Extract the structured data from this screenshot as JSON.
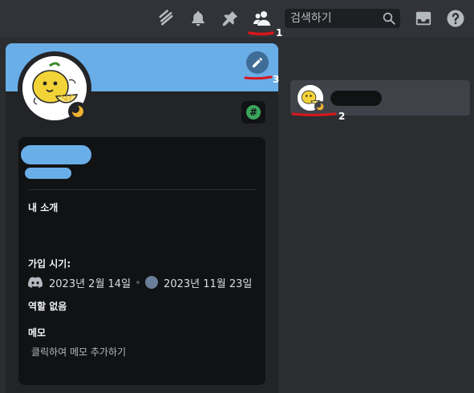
{
  "toolbar": {
    "icons": [
      "threads-icon",
      "bell-icon",
      "pin-icon",
      "members-icon",
      "inbox-icon",
      "help-icon"
    ],
    "search_placeholder": "검색하기"
  },
  "annotations": [
    "1",
    "2",
    "3"
  ],
  "profile": {
    "banner_color": "#6aaee8",
    "about_title": "내 소개",
    "member_since_title": "가입 시기:",
    "discord_join_date": "2023년 2월 14일",
    "server_join_date": "2023년 11월 23일",
    "roles_text": "역할 없음",
    "note_title": "메모",
    "note_placeholder": "클릭하여 메모 추가하기"
  },
  "colors": {
    "accent": "#6aaee8",
    "annotation": "#d9161b"
  }
}
